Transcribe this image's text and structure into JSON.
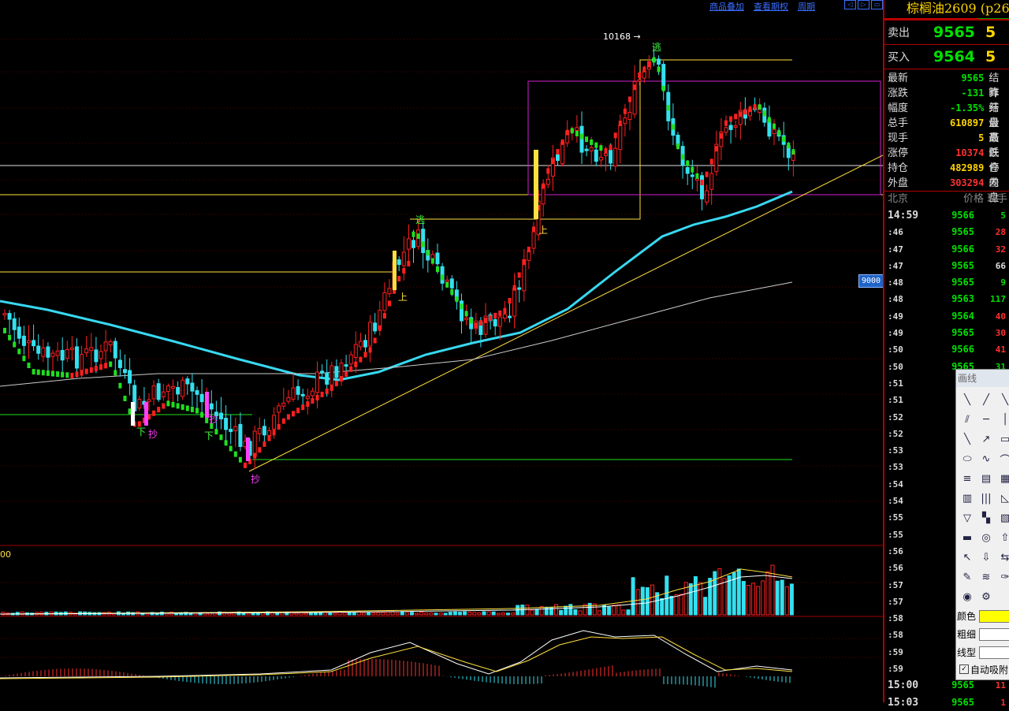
{
  "toolbar": {
    "menu": [
      "商品叠加",
      "查看期权",
      "周期"
    ],
    "nav_icons": [
      "rewind-icon",
      "forward-icon",
      "expand-icon",
      "split-icon"
    ]
  },
  "chart": {
    "price_label": "9000",
    "high_label": "10168",
    "indicator_label": "00",
    "signals": {
      "top_label": "逃",
      "up_label": "上",
      "down_label": "下",
      "buy_label": "抄"
    },
    "colors": {
      "up": "#ff2020",
      "down": "#34e0ef",
      "ma_fast": "#38d8f0",
      "ma_slow": "#cccccc",
      "trend": "#ffe040",
      "box": "#d020d0",
      "signal_up": "#ff2020",
      "signal_down": "#20e020"
    }
  },
  "panel": {
    "title": "棕榈油2609 (p26",
    "sell": {
      "label": "卖出",
      "price": "9565",
      "vol": "5"
    },
    "buy": {
      "label": "买入",
      "price": "9564",
      "vol": "5"
    },
    "stats": [
      {
        "k": "最新",
        "v": "9565",
        "c": "#00e000",
        "k2": "结算"
      },
      {
        "k": "涨跌",
        "v": "-131",
        "c": "#00e000",
        "k2": "昨结"
      },
      {
        "k": "幅度",
        "v": "-1.35%",
        "c": "#00e000",
        "k2": "开盘"
      },
      {
        "k": "总手",
        "v": "610897",
        "c": "#ffd400",
        "k2": "最高"
      },
      {
        "k": "现手",
        "v": "5",
        "c": "#ffd400",
        "k2": "最低"
      },
      {
        "k": "涨停",
        "v": "10374",
        "c": "#ff3030",
        "k2": "跌停"
      },
      {
        "k": "持仓",
        "v": "482989",
        "c": "#ffd400",
        "k2": "仓差"
      },
      {
        "k": "外盘",
        "v": "303294",
        "c": "#ff3030",
        "k2": "内盘"
      }
    ],
    "ticks_header": [
      "北京",
      "价格",
      "现手"
    ],
    "ticks": [
      {
        "t": "14:59",
        "p": "9566",
        "q": "5",
        "c": "#00e000"
      },
      {
        "t": ":46",
        "p": "9565",
        "q": "28",
        "c": "#ff3030"
      },
      {
        "t": ":47",
        "p": "9566",
        "q": "32",
        "c": "#ff3030"
      },
      {
        "t": ":47",
        "p": "9565",
        "q": "66",
        "c": "#dddddd"
      },
      {
        "t": ":48",
        "p": "9565",
        "q": "9",
        "c": "#00e000"
      },
      {
        "t": ":48",
        "p": "9563",
        "q": "117",
        "c": "#00e000"
      },
      {
        "t": ":49",
        "p": "9564",
        "q": "40",
        "c": "#ff3030"
      },
      {
        "t": ":49",
        "p": "9565",
        "q": "30",
        "c": "#ff3030"
      },
      {
        "t": ":50",
        "p": "9566",
        "q": "41",
        "c": "#ff3030"
      },
      {
        "t": ":50",
        "p": "9565",
        "q": "31",
        "c": "#00e000"
      },
      {
        "t": ":51",
        "p": "95",
        "q": "",
        "c": "#00e000"
      },
      {
        "t": ":51",
        "p": "95",
        "q": "",
        "c": "#00e000"
      },
      {
        "t": ":52",
        "p": "95",
        "q": "",
        "c": "#00e000"
      },
      {
        "t": ":52",
        "p": "95",
        "q": "",
        "c": "#00e000"
      },
      {
        "t": ":53",
        "p": "95",
        "q": "",
        "c": "#00e000"
      },
      {
        "t": ":53",
        "p": "95",
        "q": "",
        "c": "#00e000"
      },
      {
        "t": ":54",
        "p": "95",
        "q": "",
        "c": "#00e000"
      },
      {
        "t": ":54",
        "p": "95",
        "q": "",
        "c": "#00e000"
      },
      {
        "t": ":55",
        "p": "95",
        "q": "",
        "c": "#00e000"
      },
      {
        "t": ":55",
        "p": "95",
        "q": "",
        "c": "#00e000"
      },
      {
        "t": ":56",
        "p": "95",
        "q": "",
        "c": "#00e000"
      },
      {
        "t": ":56",
        "p": "95",
        "q": "",
        "c": "#00e000"
      },
      {
        "t": ":57",
        "p": "95",
        "q": "",
        "c": "#00e000"
      },
      {
        "t": ":57",
        "p": "95",
        "q": "",
        "c": "#00e000"
      },
      {
        "t": ":58",
        "p": "95",
        "q": "",
        "c": "#00e000"
      },
      {
        "t": ":58",
        "p": "95",
        "q": "",
        "c": "#00e000"
      },
      {
        "t": ":59",
        "p": "95",
        "q": "",
        "c": "#00e000"
      },
      {
        "t": ":59",
        "p": "95",
        "q": "",
        "c": "#00e000"
      },
      {
        "t": "15:00",
        "p": "9565",
        "q": "11",
        "c": "#ff3030"
      },
      {
        "t": "15:03",
        "p": "9565",
        "q": "1",
        "c": "#ff3030"
      }
    ]
  },
  "draw_tool": {
    "title": "画线",
    "tools": [
      "line-icon",
      "ray-icon",
      "segment-icon",
      "parallel-icon",
      "hline-icon",
      "vline-icon",
      "arrow-line-icon",
      "arrow-icon",
      "rect-icon",
      "ellipse-icon",
      "wave-icon",
      "arc-icon",
      "fib-icon",
      "gann-icon",
      "channel-icon",
      "cycle-icon",
      "vert-lines-icon",
      "triangle-icon",
      "abcd-icon",
      "pitchfork-icon",
      "speed-icon",
      "ruler-icon",
      "circle-target-icon",
      "up-arrow-icon",
      "red-arrow-icon",
      "green-arrow-icon",
      "swap-arrow-icon",
      "pen-icon",
      "multi-line-icon",
      "note-icon",
      "eye-icon",
      "gear-icon"
    ],
    "color_label": "颜色",
    "width_label": "粗细",
    "style_label": "线型",
    "auto_snap_label": "自动吸附",
    "color_value": "#ffff00"
  }
}
